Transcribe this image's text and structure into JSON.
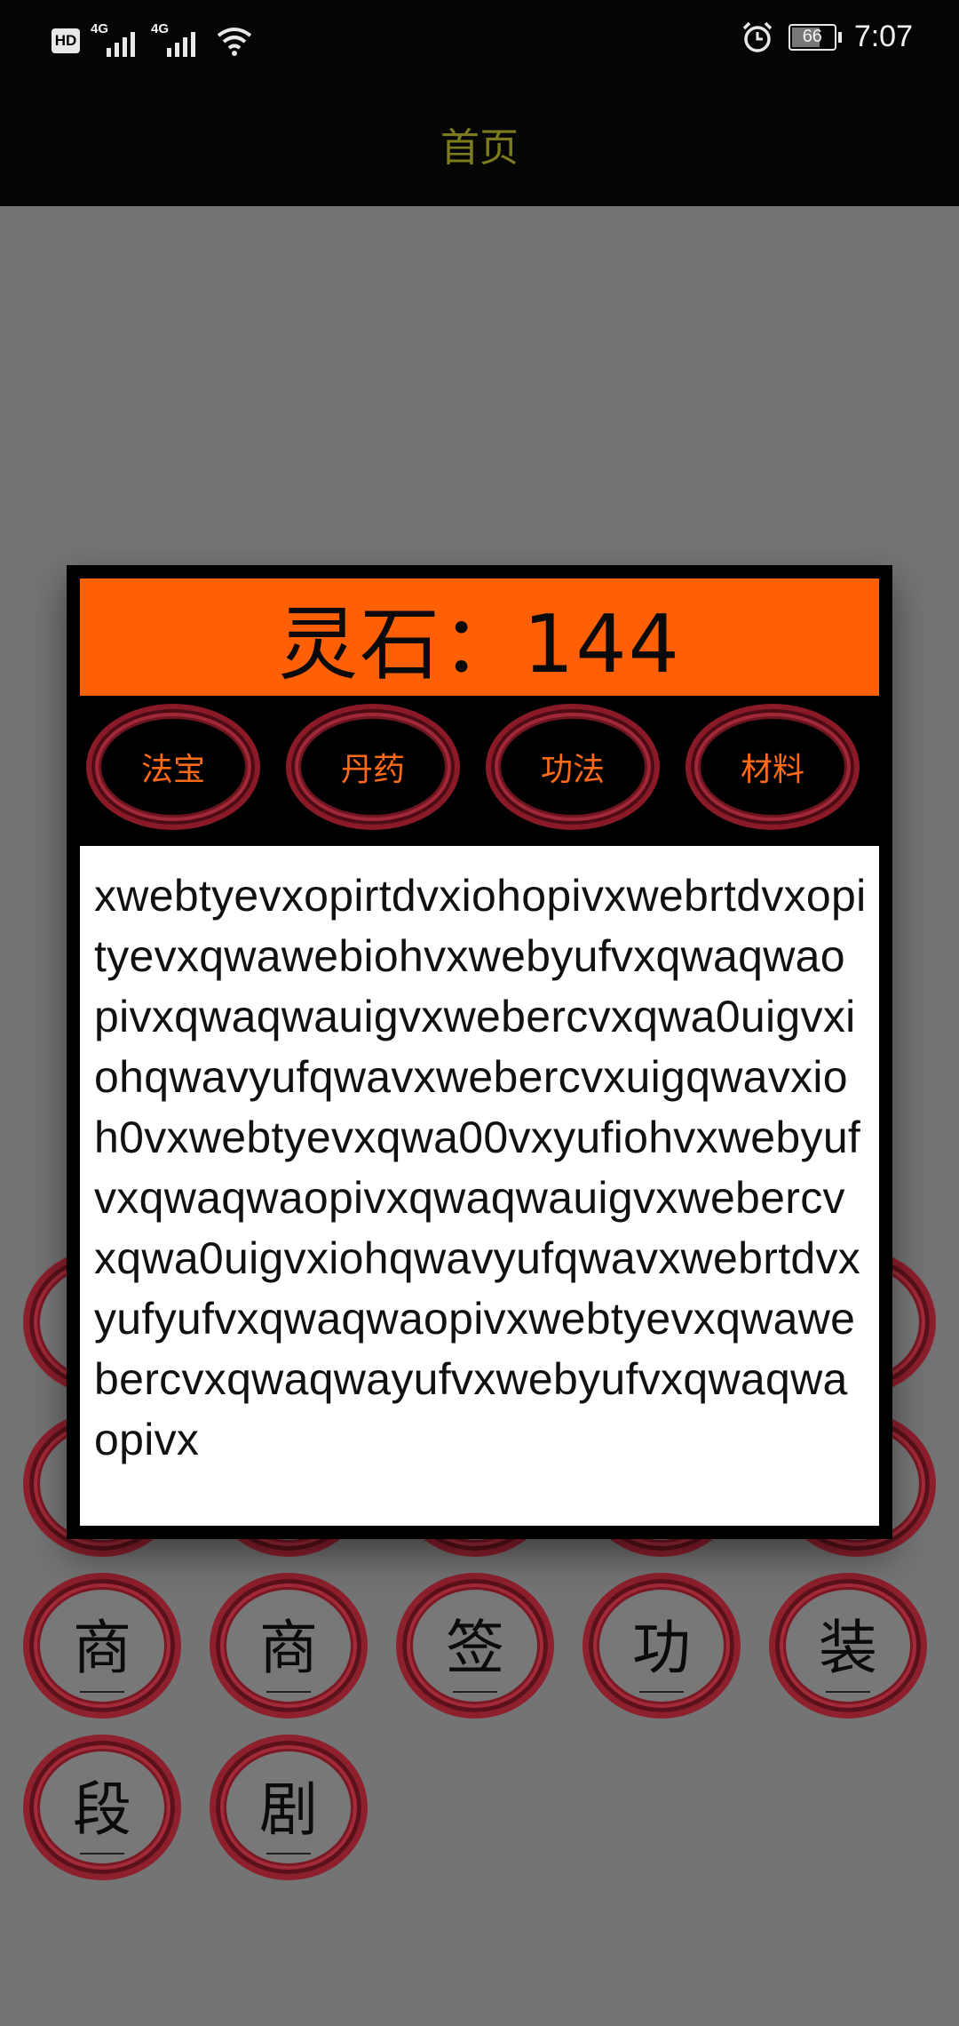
{
  "status_bar": {
    "hd": "HD",
    "net1": "4G",
    "net2": "4G",
    "battery": "66",
    "time": "7:07"
  },
  "title_bar": {
    "title": "首页"
  },
  "background_grid": {
    "row3": [
      "商",
      "商",
      "签",
      "功",
      "装"
    ],
    "row4": [
      "段",
      "剧"
    ]
  },
  "dialog": {
    "header": "灵石：144",
    "tabs": [
      "法宝",
      "丹药",
      "功法",
      "材料"
    ],
    "content": "xwebtyevxopirtdvxiohopivxwebrtdvxopityevxqwawebiohvxwebyufvxqwaqwaopivxqwaqwauigvxwebercvxqwa0uigvxiohqwavyufqwavxwebercvxuigqwavxioh0vxwebtyevxqwa00vxyufiohvxwebyufvxqwaqwaopivxqwaqwauigvxwebercvxqwa0uigvxiohqwavyufqwavxwebrtdvxyufyufvxqwaqwaopivxwebtyevxqwawebercvxqwaqwayufvxwebyufvxqwaqwaopivx"
  },
  "colors": {
    "header_orange": "#ff5f05",
    "tab_text": "#ff6a16",
    "ring_red": "#8e1f2d",
    "title_olive": "#7c7c1c",
    "dim_bg": "#747474"
  }
}
